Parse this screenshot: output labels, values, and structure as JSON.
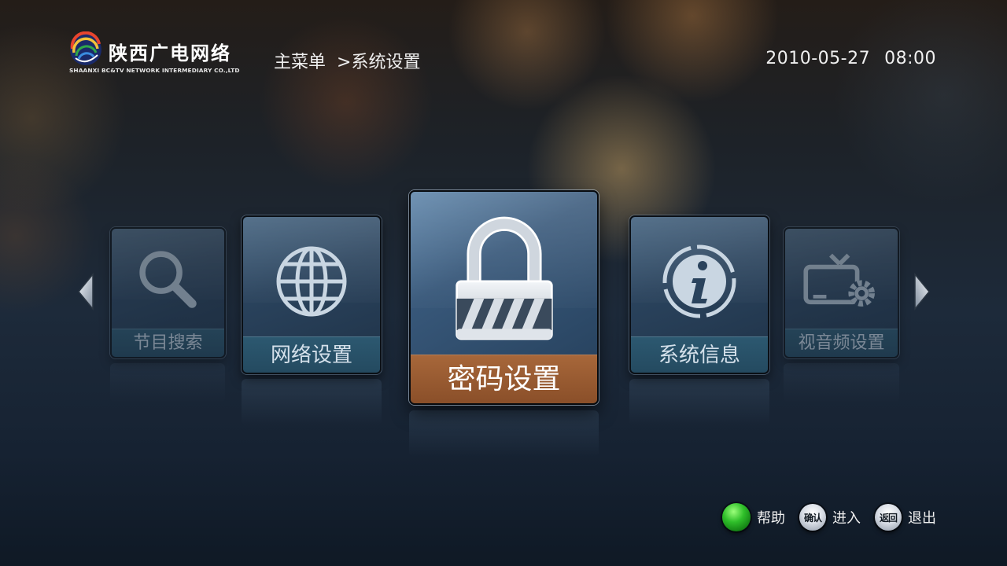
{
  "header": {
    "logo_title": "陕西广电网络",
    "logo_subtitle": "SHAANXI BC&TV NETWORK INTERMEDIARY CO.,LTD",
    "breadcrumb": [
      "主菜单",
      ">系统设置"
    ],
    "date": "2010-05-27",
    "time": "08:00"
  },
  "menu": {
    "selected_index": 2,
    "items": [
      {
        "label": "节目搜索",
        "icon": "magnifier-icon"
      },
      {
        "label": "网络设置",
        "icon": "globe-icon"
      },
      {
        "label": "密码设置",
        "icon": "padlock-icon"
      },
      {
        "label": "系统信息",
        "icon": "info-icon"
      },
      {
        "label": "视音频设置",
        "icon": "tv-settings-icon"
      }
    ]
  },
  "footer": {
    "hints": [
      {
        "key": "green-button",
        "key_label": "",
        "label": "帮助"
      },
      {
        "key": "ok-key",
        "key_label": "确认",
        "label": "进入"
      },
      {
        "key": "back-key",
        "key_label": "返回",
        "label": "退出"
      }
    ]
  },
  "colors": {
    "selected_label_bg": "#8a4f29",
    "label_bg": "#244a60",
    "help_button": "#2fbf2a"
  }
}
